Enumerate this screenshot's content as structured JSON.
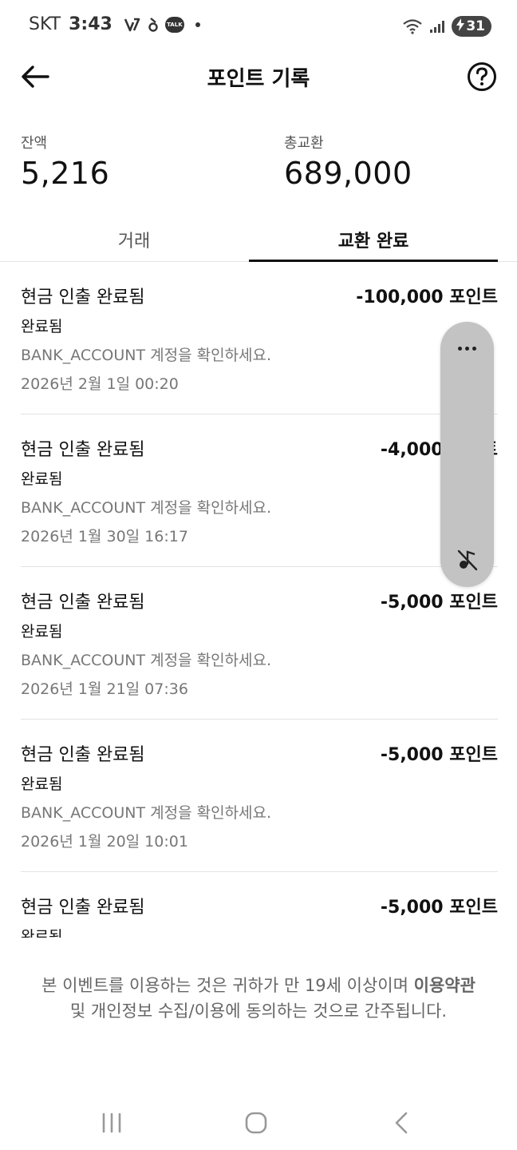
{
  "status_bar": {
    "carrier": "SKT",
    "time": "3:43",
    "talk_label": "TALK",
    "battery_level": "31"
  },
  "header": {
    "title": "포인트 기록"
  },
  "summary": {
    "balance_label": "잔액",
    "balance_value": "5,216",
    "total_label": "총교환",
    "total_value": "689,000"
  },
  "tabs": [
    {
      "label": "거래",
      "active": false
    },
    {
      "label": "교환 완료",
      "active": true
    }
  ],
  "transactions": [
    {
      "title": "현금 인출 완료됨",
      "amount": "-100,000 포인트",
      "status": "완료됨",
      "note": "BANK_ACCOUNT 계정을 확인하세요.",
      "date": "2026년 2월 1일 00:20"
    },
    {
      "title": "현금 인출 완료됨",
      "amount": "-4,000 포인트",
      "status": "완료됨",
      "note": "BANK_ACCOUNT 계정을 확인하세요.",
      "date": "2026년 1월 30일 16:17"
    },
    {
      "title": "현금 인출 완료됨",
      "amount": "-5,000 포인트",
      "status": "완료됨",
      "note": "BANK_ACCOUNT 계정을 확인하세요.",
      "date": "2026년 1월 21일 07:36"
    },
    {
      "title": "현금 인출 완료됨",
      "amount": "-5,000 포인트",
      "status": "완료됨",
      "note": "BANK_ACCOUNT 계정을 확인하세요.",
      "date": "2026년 1월 20일 10:01"
    },
    {
      "title": "현금 인출 완료됨",
      "amount": "-5,000 포인트",
      "status": "완료됨",
      "note": "",
      "date": ""
    }
  ],
  "notice": {
    "text_before": "본 이벤트를 이용하는 것은 귀하가 만 19세 이상이며 ",
    "terms_link": "이용약관",
    "text_after": " 및 개인정보 수집/이용에 동의하는 것으로 간주됩니다."
  },
  "icons": {
    "back": "arrow-left-icon",
    "help": "question-circle-icon",
    "more": "more-dots-icon",
    "mute": "music-note-off-icon"
  }
}
